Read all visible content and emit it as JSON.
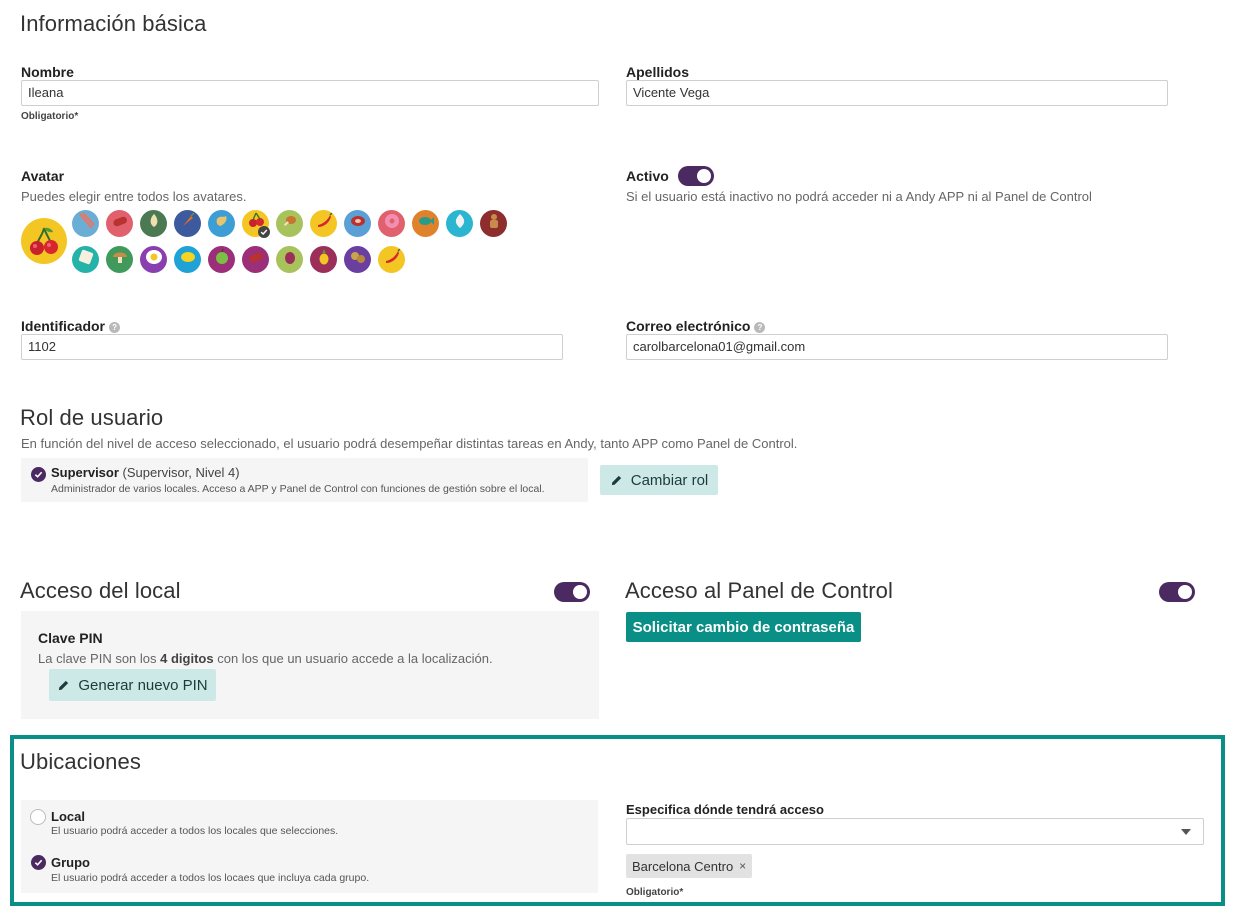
{
  "basic": {
    "title": "Información básica",
    "nombre_label": "Nombre",
    "nombre_value": "Ileana",
    "nombre_req": "Obligatorio*",
    "apellidos_label": "Apellidos",
    "apellidos_value": "Vicente Vega"
  },
  "avatar": {
    "label": "Avatar",
    "help": "Puedes elegir entre todos los avatares.",
    "selected_icon": "cherry-icon",
    "row1": [
      {
        "icon": "bacon-icon",
        "color": "#6aaed6"
      },
      {
        "icon": "sausage-icon",
        "color": "#e0606e"
      },
      {
        "icon": "garlic-icon",
        "color": "#4b7a52"
      },
      {
        "icon": "carrot-icon",
        "color": "#3d5a9e"
      },
      {
        "icon": "ginger-icon",
        "color": "#3d9ed6"
      },
      {
        "icon": "cherry-icon",
        "color": "#f3c623"
      },
      {
        "icon": "drumstick-icon",
        "color": "#a8c35c"
      },
      {
        "icon": "chili-icon",
        "color": "#f3c623"
      },
      {
        "icon": "steak-icon",
        "color": "#5aa0d6"
      },
      {
        "icon": "donut-icon",
        "color": "#e0606e"
      },
      {
        "icon": "fish-icon",
        "color": "#e0822c"
      },
      {
        "icon": "onion-icon",
        "color": "#2ab6d0"
      },
      {
        "icon": "cookie-man-icon",
        "color": "#8e2d2d"
      }
    ],
    "row2": [
      {
        "icon": "toast-icon",
        "color": "#25b2a8"
      },
      {
        "icon": "mushroom-icon",
        "color": "#3f9a5c"
      },
      {
        "icon": "egg-icon",
        "color": "#8a3fb0"
      },
      {
        "icon": "lemon-icon",
        "color": "#1fa3d6"
      },
      {
        "icon": "apple-icon",
        "color": "#9c2f7a"
      },
      {
        "icon": "sausage-icon",
        "color": "#9c2f7a"
      },
      {
        "icon": "potato-icon",
        "color": "#a8c35c"
      },
      {
        "icon": "pineapple-icon",
        "color": "#9c2f5a"
      },
      {
        "icon": "potatoes-icon",
        "color": "#6a3fa0"
      },
      {
        "icon": "chili-icon",
        "color": "#f3c623"
      }
    ],
    "selected_index": 5
  },
  "active": {
    "label": "Activo",
    "help": "Si el usuario está inactivo no podrá acceder ni a Andy APP ni al Panel de Control"
  },
  "ident": {
    "label": "Identificador",
    "value": "1102",
    "email_label": "Correo electrónico",
    "email_value": "carolbarcelona01@gmail.com"
  },
  "role": {
    "title": "Rol de usuario",
    "help": "En función del nivel de acceso seleccionado, el usuario podrá desempeñar distintas tareas en Andy, tanto APP como Panel de Control.",
    "name": "Supervisor",
    "level": "(Supervisor, Nivel 4)",
    "desc": "Administrador de varios locales. Acceso a APP y Panel de Control con funciones de gestión sobre el local.",
    "change_button": "Cambiar rol"
  },
  "local_access": {
    "title": "Acceso del local",
    "pin_label": "Clave PIN",
    "pin_help_pre": "La clave PIN son los",
    "pin_help_bold": "4 digitos",
    "pin_help_post": "con los que un usuario accede a la localización.",
    "generate_button": "Generar nuevo PIN"
  },
  "panel_access": {
    "title": "Acceso al Panel de Control",
    "request_button": "Solicitar cambio de contraseña"
  },
  "locations": {
    "title": "Ubicaciones",
    "local_label": "Local",
    "local_help": "El usuario podrá acceder a todos los locales que selecciones.",
    "group_label": "Grupo",
    "group_help": "El usuario podrá acceder a todos los locaes que incluya cada grupo.",
    "specify_label": "Especifica dónde tendrá acceso",
    "tag": "Barcelona Centro",
    "required": "Obligatorio*",
    "selected": "group"
  },
  "colors": {
    "accent_purple": "#4b2a61",
    "teal": "#0a8f86",
    "teal_light": "#cde9e7",
    "highlight_border": "#0a8f86"
  }
}
